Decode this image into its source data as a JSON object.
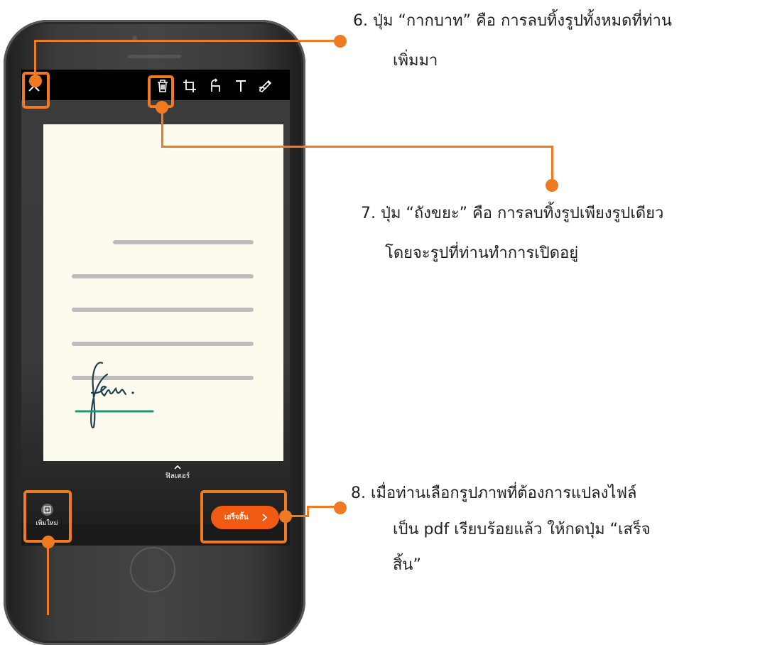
{
  "annotations": {
    "note6_line1": "6.  ปุ่ม “กากบาท” คือ การลบทิ้งรูปทั้งหมดที่ท่าน",
    "note6_line2": "เพิ่มมา",
    "note7_line1": "7.  ปุ่ม “ถังขยะ” คือ การลบทิ้งรูปเพียงรูปเดียว",
    "note7_line2": "โดยจะรูปที่ท่านทำการเปิดอยู่",
    "note8_line1": "8. เมื่อท่านเลือกรูปภาพที่ต้องการแปลงไฟล์",
    "note8_line2": "เป็น pdf เรียบร้อยแล้ว ให้กดปุ่ม “เสร็จ",
    "note8_line3": "สิ้น”"
  },
  "screen": {
    "toolbar_icons": [
      "close-icon",
      "trash-icon",
      "crop-icon",
      "rotate-icon",
      "text-icon",
      "draw-icon"
    ],
    "filter_label": "ฟิลเตอร์",
    "add_new_label": "เพิ่มใหม่",
    "done_label": "เสร็จสิ้น"
  },
  "colors": {
    "accent": "#f07a22",
    "done_button": "#f05a12",
    "document_bg": "#fdfbee",
    "signature_ink": "#1f3f4e",
    "signature_underline": "#169a7c"
  }
}
